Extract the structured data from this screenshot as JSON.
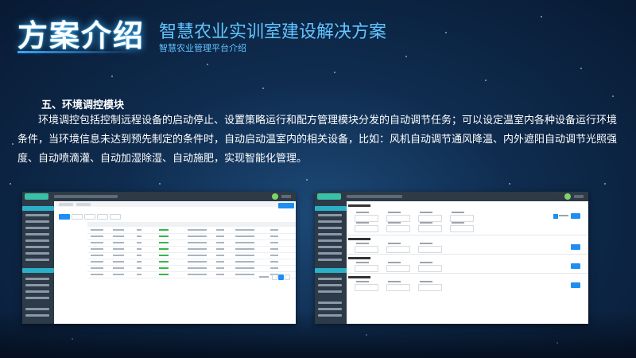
{
  "header": {
    "title": "方案介绍",
    "subtitle": "智慧农业实训室建设解决方案",
    "caption": "智慧农业管理平台介绍"
  },
  "section": {
    "heading": "五、环境调控模块",
    "body": "环境调控包括控制远程设备的启动停止、设置策略运行和配方管理模块分发的自动调节任务；可以设定温室内各种设备运行环境条件，当环境信息未达到预先制定的条件时，自动启动温室内的相关设备，比如：风机自动调节通风降温、内外遮阳自动调节光照强度、自动喷滴灌、自动加湿除湿、自动施肥，实现智能化管理。"
  },
  "colors": {
    "accent": "#62c4ff",
    "title_glow": "#3aa7ff",
    "sidebar": "#2d3b48",
    "sidebar_active": "#2ab1c9",
    "primary_button": "#1f8ef1",
    "status_green": "#39b54a"
  },
  "screenshots": {
    "left": {
      "view": "strategy-list",
      "rows": 8
    },
    "right": {
      "view": "environment-settings-form",
      "sections": 4
    }
  }
}
